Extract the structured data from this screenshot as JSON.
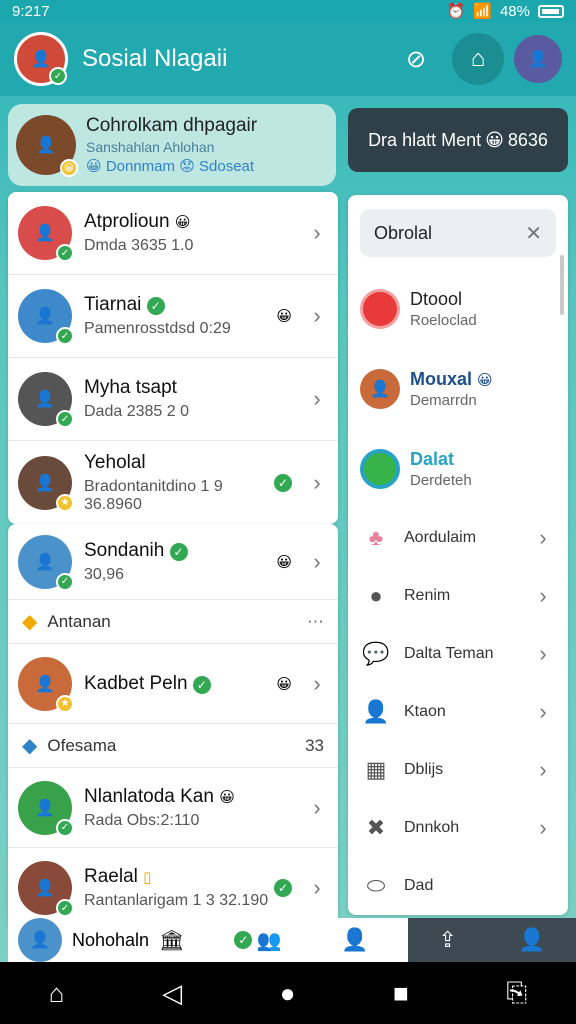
{
  "status": {
    "time": "9:217",
    "battery": "48%"
  },
  "app": {
    "title": "Sosial Nlagaii"
  },
  "profile": {
    "name": "Cohrolkam dhpagair",
    "sub": "Sanshahlan Ahlohan",
    "tags": "Donnmam",
    "tags2": "Sdoseat"
  },
  "dark_button": {
    "label": "Dra hlatt Ment",
    "suffix": "8636"
  },
  "contacts_top": [
    {
      "name": "Atprolioun",
      "sub": "Dmda 3635 1.0",
      "badge": "😀",
      "color": "#d84c4c"
    },
    {
      "name": "Tiarnai",
      "sub": "Pamenrosstdsd 0:29",
      "badge": "✓",
      "color": "#3d89c9"
    },
    {
      "name": "Myha tsapt",
      "sub": "Dada 2385 2 0",
      "badge": "",
      "color": "#555"
    },
    {
      "name": "Yeholal",
      "sub": "Bradontanitdino 1 9 36.8960",
      "badge": "",
      "color": "#6a4a3a"
    }
  ],
  "contacts_bottom": [
    {
      "name": "Sondanih",
      "sub": "30,96",
      "color": "#4a92c9"
    },
    {
      "section": "Antanan",
      "count": ""
    },
    {
      "name": "Kadbet Peln",
      "sub": "",
      "color": "#c96a3a"
    },
    {
      "section": "Ofesama",
      "count": "33"
    },
    {
      "name": "Nlanlatoda Kan",
      "sub": "Rada Obs:2:110",
      "color": "#37a24a"
    },
    {
      "name": "Raelal",
      "sub": "Rantanlarigam 1 3 32.190",
      "color": "#8a4a3a"
    }
  ],
  "bottom_partial": {
    "name": "Nohohaln"
  },
  "right_panel": {
    "search_value": "Obrolal",
    "people": [
      {
        "name": "Dtoool",
        "sub": "Roeloclad",
        "color": "#e83a3a"
      },
      {
        "name": "Mouxal",
        "sub": "Demarrdn",
        "color": "#3d89c9"
      },
      {
        "name": "Dalat",
        "sub": "Derdeteh",
        "color": "#27a3c6"
      }
    ],
    "menu": [
      {
        "label": "Aordulaim",
        "icon": "people-icon"
      },
      {
        "label": "Renim",
        "icon": "person-icon"
      },
      {
        "label": "Dalta Teman",
        "icon": "chat-icon"
      },
      {
        "label": "Ktaon",
        "icon": "user-icon"
      },
      {
        "label": "Dblijs",
        "icon": "grid-icon"
      },
      {
        "label": "Dnnkoh",
        "icon": "tool-icon"
      },
      {
        "label": "Dad",
        "icon": "shield-icon"
      }
    ]
  }
}
